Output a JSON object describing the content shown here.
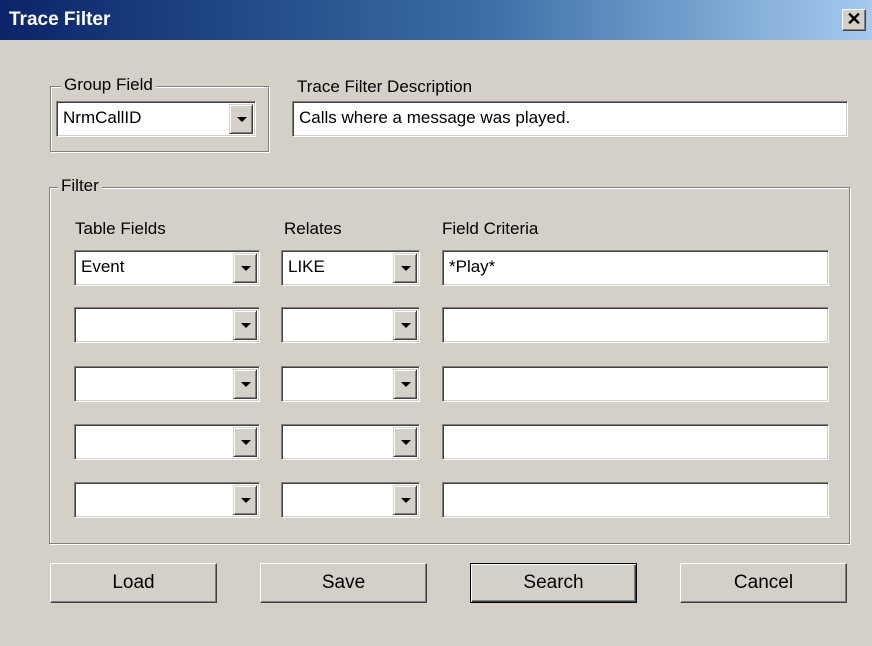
{
  "window": {
    "title": "Trace Filter",
    "close_glyph": "✕"
  },
  "group_field": {
    "legend": "Group Field",
    "value": "NrmCallID"
  },
  "description": {
    "label": "Trace Filter Description",
    "value": "Calls where a message was played."
  },
  "filter": {
    "legend": "Filter",
    "headers": {
      "table_fields": "Table Fields",
      "relates": "Relates",
      "field_criteria": "Field Criteria"
    },
    "rows": [
      {
        "table_field": "Event",
        "relates": "LIKE",
        "criteria": "*Play*"
      },
      {
        "table_field": "",
        "relates": "",
        "criteria": ""
      },
      {
        "table_field": "",
        "relates": "",
        "criteria": ""
      },
      {
        "table_field": "",
        "relates": "",
        "criteria": ""
      },
      {
        "table_field": "",
        "relates": "",
        "criteria": ""
      }
    ]
  },
  "buttons": {
    "load": "Load",
    "save": "Save",
    "search": "Search",
    "cancel": "Cancel"
  }
}
